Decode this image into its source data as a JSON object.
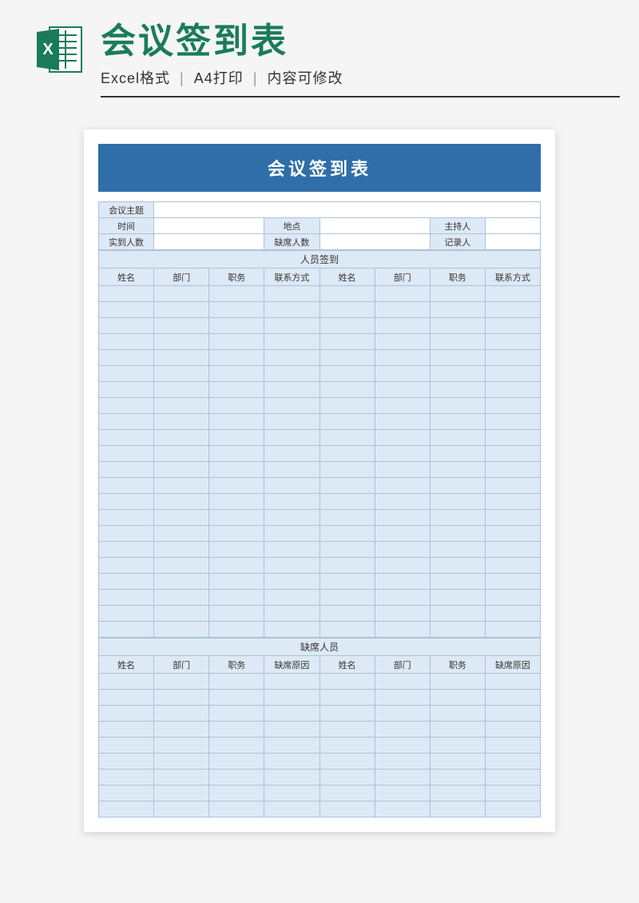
{
  "header": {
    "title": "会议签到表",
    "sub1": "Excel格式",
    "sub2": "A4打印",
    "sub3": "内容可修改"
  },
  "sheet": {
    "title": "会议签到表",
    "info_labels": {
      "topic": "会议主题",
      "time": "时间",
      "location": "地点",
      "host": "主持人",
      "actual_count": "实到人数",
      "absent_count": "缺席人数",
      "recorder": "记录人"
    },
    "attendance": {
      "section_title": "人员签到",
      "columns": [
        "姓名",
        "部门",
        "职务",
        "联系方式",
        "姓名",
        "部门",
        "职务",
        "联系方式"
      ],
      "empty_rows": 22
    },
    "absence": {
      "section_title": "缺席人员",
      "columns": [
        "姓名",
        "部门",
        "职务",
        "缺席原因",
        "姓名",
        "部门",
        "职务",
        "缺席原因"
      ],
      "empty_rows": 9
    }
  }
}
